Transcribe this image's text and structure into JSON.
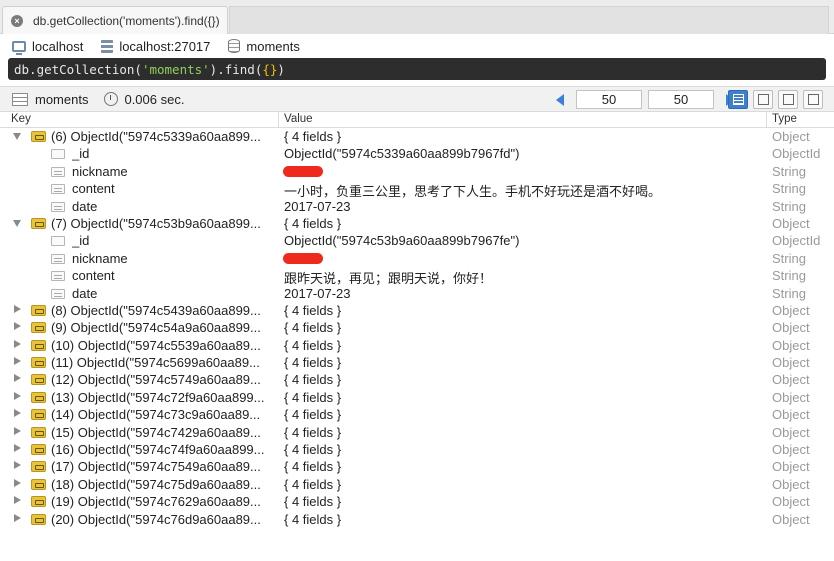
{
  "tab": {
    "title": "db.getCollection('moments').find({})"
  },
  "connection": {
    "host": "localhost",
    "server": "localhost:27017",
    "database": "moments"
  },
  "query": {
    "prefix": "db.getCollection(",
    "collection": "'moments'",
    "method": ").find(",
    "filter": "{}",
    "suffix": ")"
  },
  "results": {
    "collection": "moments",
    "time": "0.006 sec.",
    "skip": "50",
    "limit": "50"
  },
  "columns": {
    "key": "Key",
    "value": "Value",
    "type": "Type"
  },
  "rows": [
    {
      "kind": "doc",
      "expanded": true,
      "key": "(6) ObjectId(\"5974c5339a60aa899...",
      "value": "{ 4 fields }",
      "type": "Object"
    },
    {
      "kind": "field",
      "ficon": "oid",
      "key": "_id",
      "value": "ObjectId(\"5974c5339a60aa899b7967fd\")",
      "type": "ObjectId"
    },
    {
      "kind": "field",
      "ficon": "str",
      "key": "nickname",
      "value": "",
      "redacted": true,
      "type": "String"
    },
    {
      "kind": "field",
      "ficon": "str",
      "key": "content",
      "value": "一小时，负重三公里，思考了下人生。手机不好玩还是酒不好喝。",
      "type": "String"
    },
    {
      "kind": "field",
      "ficon": "str",
      "key": "date",
      "value": "2017-07-23",
      "type": "String"
    },
    {
      "kind": "doc",
      "expanded": true,
      "key": "(7) ObjectId(\"5974c53b9a60aa899...",
      "value": "{ 4 fields }",
      "type": "Object"
    },
    {
      "kind": "field",
      "ficon": "oid",
      "key": "_id",
      "value": "ObjectId(\"5974c53b9a60aa899b7967fe\")",
      "type": "ObjectId"
    },
    {
      "kind": "field",
      "ficon": "str",
      "key": "nickname",
      "value": "",
      "redacted": true,
      "type": "String"
    },
    {
      "kind": "field",
      "ficon": "str",
      "key": "content",
      "value": "跟昨天说，再见；跟明天说，你好！",
      "type": "String"
    },
    {
      "kind": "field",
      "ficon": "str",
      "key": "date",
      "value": "2017-07-23",
      "type": "String"
    },
    {
      "kind": "doc",
      "expanded": false,
      "key": "(8) ObjectId(\"5974c5439a60aa899...",
      "value": "{ 4 fields }",
      "type": "Object"
    },
    {
      "kind": "doc",
      "expanded": false,
      "key": "(9) ObjectId(\"5974c54a9a60aa899...",
      "value": "{ 4 fields }",
      "type": "Object"
    },
    {
      "kind": "doc",
      "expanded": false,
      "key": "(10) ObjectId(\"5974c5539a60aa89...",
      "value": "{ 4 fields }",
      "type": "Object"
    },
    {
      "kind": "doc",
      "expanded": false,
      "key": "(11) ObjectId(\"5974c5699a60aa89...",
      "value": "{ 4 fields }",
      "type": "Object"
    },
    {
      "kind": "doc",
      "expanded": false,
      "key": "(12) ObjectId(\"5974c5749a60aa89...",
      "value": "{ 4 fields }",
      "type": "Object"
    },
    {
      "kind": "doc",
      "expanded": false,
      "key": "(13) ObjectId(\"5974c72f9a60aa899...",
      "value": "{ 4 fields }",
      "type": "Object"
    },
    {
      "kind": "doc",
      "expanded": false,
      "key": "(14) ObjectId(\"5974c73c9a60aa89...",
      "value": "{ 4 fields }",
      "type": "Object"
    },
    {
      "kind": "doc",
      "expanded": false,
      "key": "(15) ObjectId(\"5974c7429a60aa89...",
      "value": "{ 4 fields }",
      "type": "Object"
    },
    {
      "kind": "doc",
      "expanded": false,
      "key": "(16) ObjectId(\"5974c74f9a60aa899...",
      "value": "{ 4 fields }",
      "type": "Object"
    },
    {
      "kind": "doc",
      "expanded": false,
      "key": "(17) ObjectId(\"5974c7549a60aa89...",
      "value": "{ 4 fields }",
      "type": "Object"
    },
    {
      "kind": "doc",
      "expanded": false,
      "key": "(18) ObjectId(\"5974c75d9a60aa89...",
      "value": "{ 4 fields }",
      "type": "Object"
    },
    {
      "kind": "doc",
      "expanded": false,
      "key": "(19) ObjectId(\"5974c7629a60aa89...",
      "value": "{ 4 fields }",
      "type": "Object"
    },
    {
      "kind": "doc",
      "expanded": false,
      "key": "(20) ObjectId(\"5974c76d9a60aa89...",
      "value": "{ 4 fields }",
      "type": "Object"
    }
  ]
}
